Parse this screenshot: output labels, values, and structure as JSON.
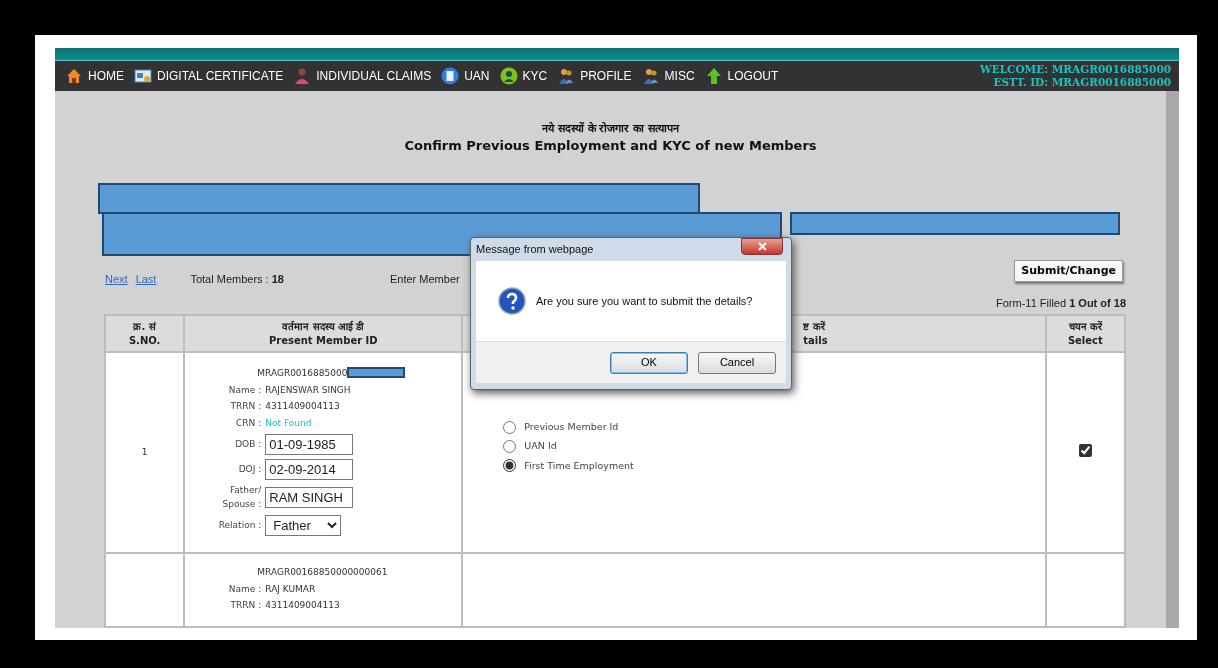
{
  "nav": {
    "items": [
      {
        "label": "HOME"
      },
      {
        "label": "DIGITAL CERTIFICATE"
      },
      {
        "label": "INDIVIDUAL CLAIMS"
      },
      {
        "label": "UAN"
      },
      {
        "label": "KYC"
      },
      {
        "label": "PROFILE"
      },
      {
        "label": "MISC"
      },
      {
        "label": "LOGOUT"
      }
    ],
    "welcome": [
      "WELCOME: MRAGR0016885000",
      "ESTT. ID: MRAGR0016885000"
    ]
  },
  "heading": {
    "hindi": "नये सदस्यों के रोजगार का सत्यापन",
    "english": "Confirm Previous Employment and KYC of new Members"
  },
  "pager": {
    "links": [
      "Next",
      "Last"
    ],
    "total": "Total Members : **18**",
    "search_label": "Enter Member"
  },
  "submit_button": "Submit/Change",
  "form_status": "Form-11 Filled **1 Out of 18**",
  "table": {
    "columns": [
      {
        "hindi": "क्र. सं",
        "english": "S.NO."
      },
      {
        "hindi": "वर्तमान सदस्य आई डी",
        "english": "Present Member ID"
      },
      {
        "hindi": "ष्ट करें",
        "english": "tails"
      },
      {
        "hindi": "चयन करें",
        "english": "Select"
      }
    ],
    "rows": [
      {
        "sno": "1",
        "member_id": "MRAGR0016885000",
        "id_redacted": true,
        "fields": [
          {
            "kind": "text",
            "label": "Name :",
            "value": "RAJENSWAR SINGH"
          },
          {
            "kind": "text",
            "label": "TRRN :",
            "value": "4311409004113"
          },
          {
            "kind": "status",
            "label": "CRN :",
            "value": "Not Found"
          },
          {
            "kind": "input",
            "label": "DOB :",
            "value": "01-09-1985"
          },
          {
            "kind": "input",
            "label": "DOJ :",
            "value": "02-09-2014"
          },
          {
            "kind": "input",
            "label": "Father/ Spouse :",
            "value": "RAM SINGH"
          },
          {
            "kind": "select",
            "label": "Relation :",
            "value": "Father"
          }
        ],
        "options": [
          {
            "label": "Previous Member Id",
            "selected": false
          },
          {
            "label": "UAN Id",
            "selected": false
          },
          {
            "label": "First Time Employment",
            "selected": true
          }
        ],
        "checked": true
      },
      {
        "member_id": "MRAGR00168850000000061",
        "id_redacted": false,
        "fields": [
          {
            "kind": "text",
            "label": "Name :",
            "value": "RAJ KUMAR"
          },
          {
            "kind": "text",
            "label": "TRRN :",
            "value": "4311409004113"
          }
        ]
      }
    ]
  },
  "dialog": {
    "title": "Message from webpage",
    "message": "Are you sure you want to submit the details?",
    "buttons": [
      {
        "label": "OK",
        "selected": true
      },
      {
        "label": "Cancel",
        "selected": false
      }
    ]
  }
}
